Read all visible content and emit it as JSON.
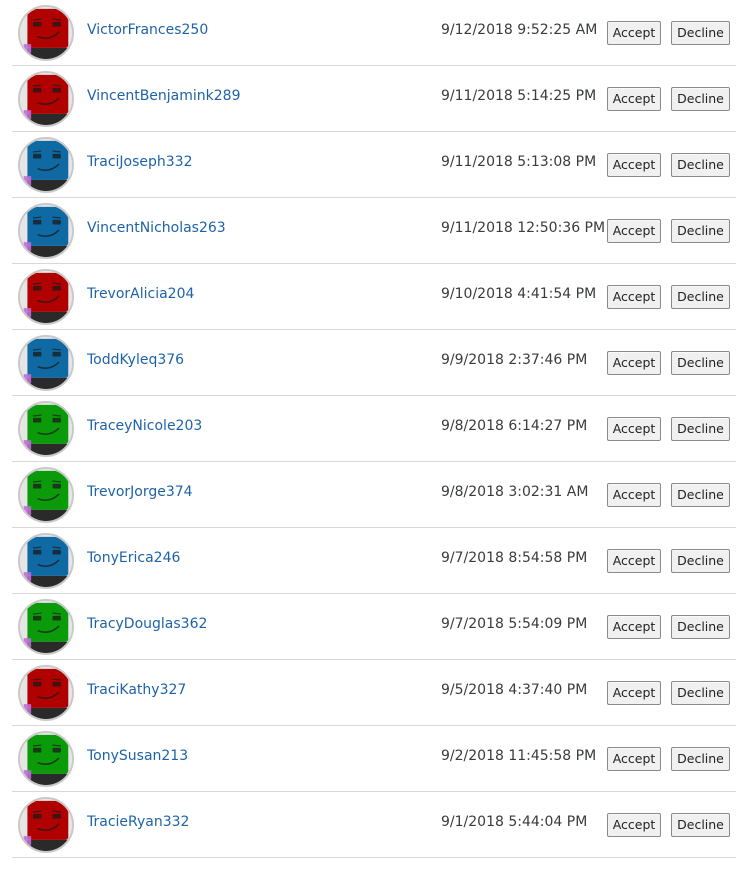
{
  "buttons": {
    "accept_label": "Accept",
    "decline_label": "Decline"
  },
  "colors": {
    "red": "#b00000",
    "blue": "#0f6aa3",
    "green": "#0a9a0a",
    "link": "#1e63a8"
  },
  "requests": [
    {
      "username": "VictorFrances250",
      "date": "9/12/2018 9:52:25 AM",
      "avatar_color": "red"
    },
    {
      "username": "VincentBenjamink289",
      "date": "9/11/2018 5:14:25 PM",
      "avatar_color": "red"
    },
    {
      "username": "TraciJoseph332",
      "date": "9/11/2018 5:13:08 PM",
      "avatar_color": "blue"
    },
    {
      "username": "VincentNicholas263",
      "date": "9/11/2018 12:50:36 PM",
      "avatar_color": "blue"
    },
    {
      "username": "TrevorAlicia204",
      "date": "9/10/2018 4:41:54 PM",
      "avatar_color": "red"
    },
    {
      "username": "ToddKyleq376",
      "date": "9/9/2018 2:37:46 PM",
      "avatar_color": "blue"
    },
    {
      "username": "TraceyNicole203",
      "date": "9/8/2018 6:14:27 PM",
      "avatar_color": "green"
    },
    {
      "username": "TrevorJorge374",
      "date": "9/8/2018 3:02:31 AM",
      "avatar_color": "green"
    },
    {
      "username": "TonyErica246",
      "date": "9/7/2018 8:54:58 PM",
      "avatar_color": "blue"
    },
    {
      "username": "TracyDouglas362",
      "date": "9/7/2018 5:54:09 PM",
      "avatar_color": "green"
    },
    {
      "username": "TraciKathy327",
      "date": "9/5/2018 4:37:40 PM",
      "avatar_color": "red"
    },
    {
      "username": "TonySusan213",
      "date": "9/2/2018 11:45:58 PM",
      "avatar_color": "green"
    },
    {
      "username": "TracieRyan332",
      "date": "9/1/2018 5:44:04 PM",
      "avatar_color": "red"
    }
  ]
}
